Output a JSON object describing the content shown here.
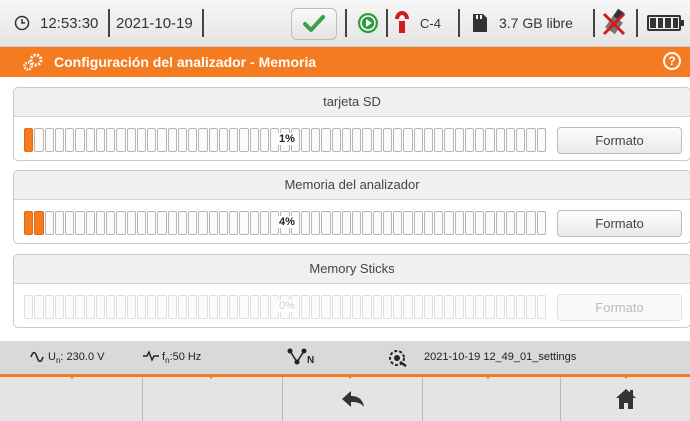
{
  "status": {
    "time": "12:53:30",
    "date": "2021-10-19",
    "clamp_label": "C-4",
    "storage_free": "3.7 GB libre"
  },
  "title": {
    "text": "Configuración del analizador - Memoria",
    "help_label": "?"
  },
  "panels": [
    {
      "title": "tarjeta SD",
      "percent_label": "1%",
      "usage_fraction": 0.01,
      "button_label": "Formato",
      "enabled": true
    },
    {
      "title": "Memoria del analizador",
      "percent_label": "4%",
      "usage_fraction": 0.04,
      "button_label": "Formato",
      "enabled": true
    },
    {
      "title": "Memory Sticks",
      "percent_label": "0%",
      "usage_fraction": 0.0,
      "button_label": "Formato",
      "enabled": false
    }
  ],
  "info": {
    "voltage": "230.0 V",
    "voltage_prefix": "U",
    "voltage_sub": "n",
    "frequency": ":50 Hz",
    "frequency_prefix": "f",
    "frequency_sub": "n",
    "network_sub": "N",
    "settings_file": "2021-10-19 12_49_01_settings"
  },
  "colors": {
    "accent": "#f47b20",
    "check_green": "#3aa14a"
  },
  "function_keys": [
    {
      "icon": "",
      "enabled": false
    },
    {
      "icon": "",
      "enabled": false
    },
    {
      "icon": "back-arrow-icon",
      "enabled": true
    },
    {
      "icon": "",
      "enabled": false
    },
    {
      "icon": "home-icon",
      "enabled": true
    }
  ]
}
